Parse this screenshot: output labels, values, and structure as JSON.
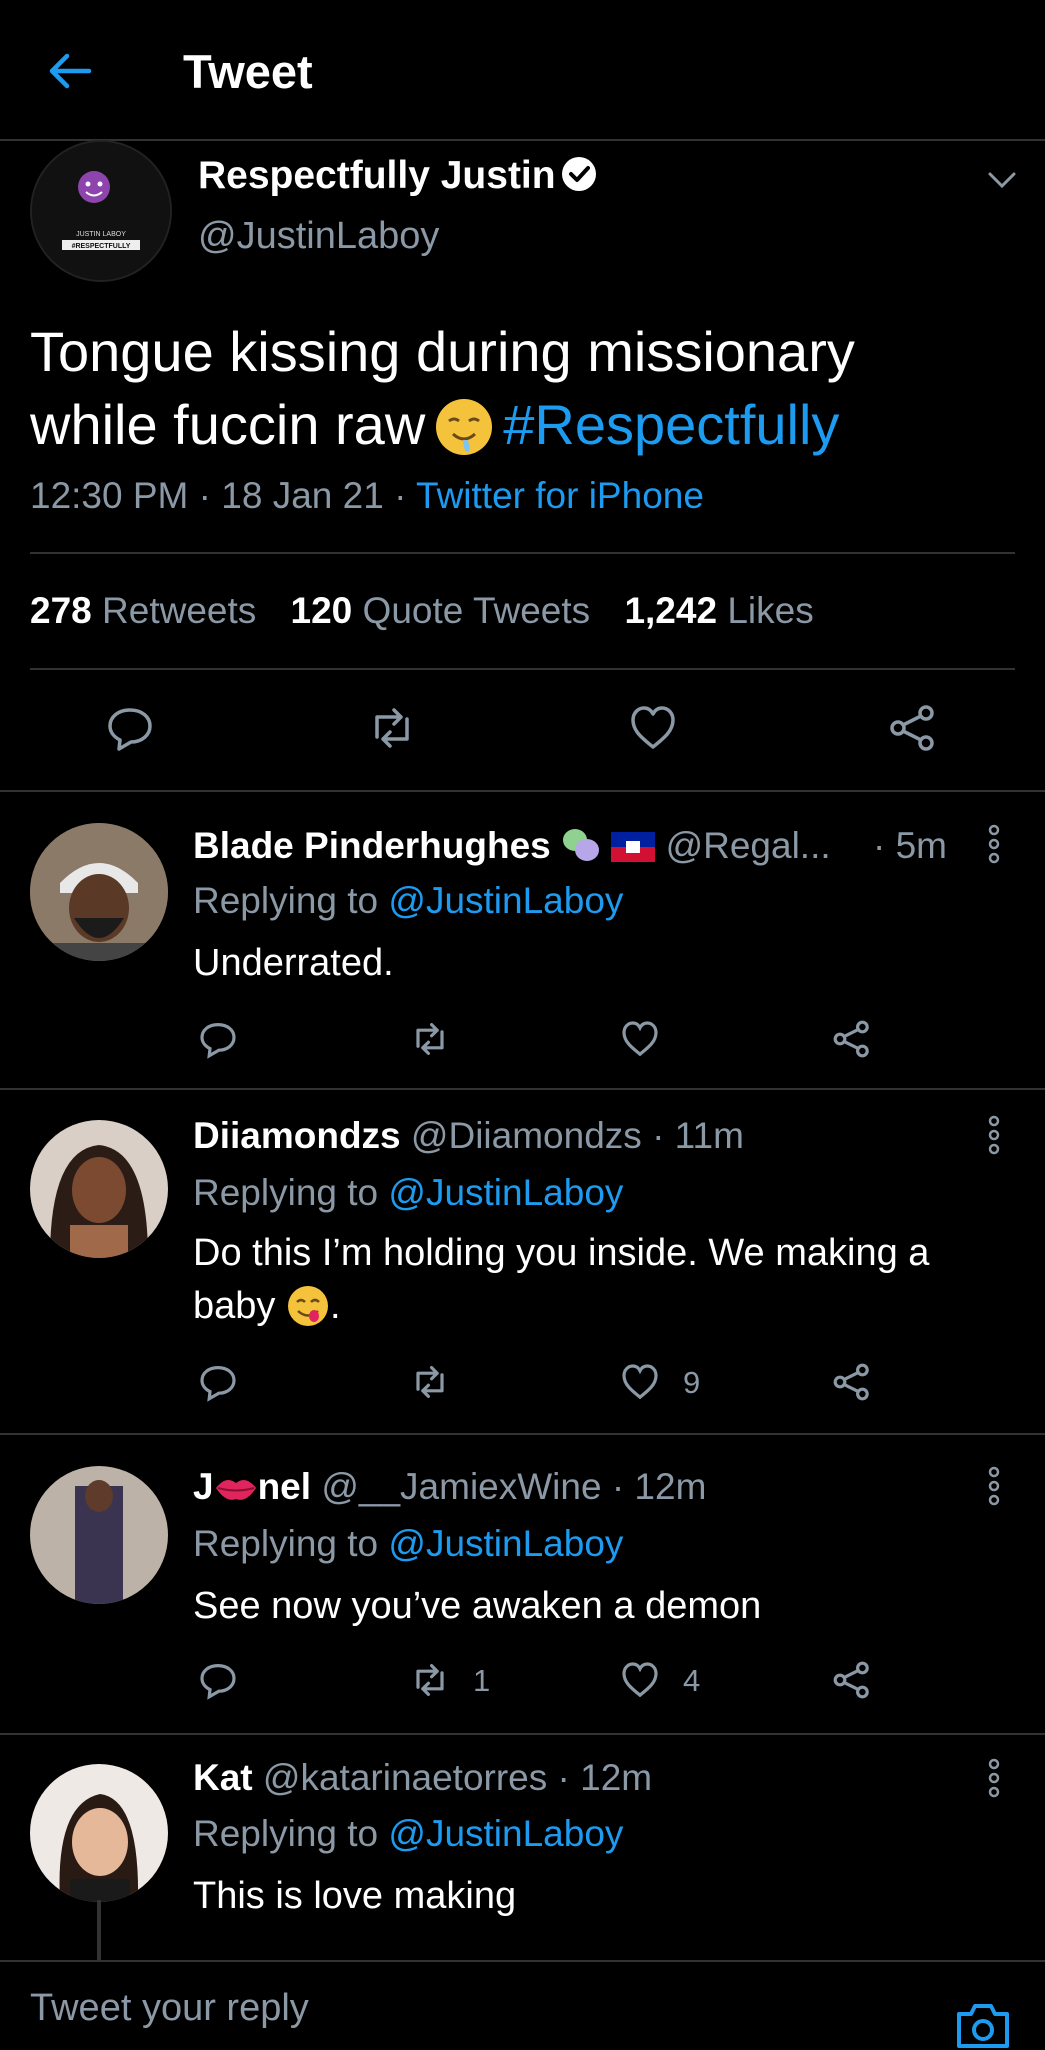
{
  "header": {
    "title": "Tweet"
  },
  "tweet": {
    "author_name": "Respectfully Justin",
    "author_handle": "@JustinLaboy",
    "text_line1": "Tongue kissing during missionary",
    "text_line2": "while fuccin raw",
    "hashtag": "#Respectfully",
    "time": "12:30 PM",
    "date": "18 Jan 21",
    "source": "Twitter for iPhone",
    "retweets_count": "278",
    "retweets_label": "Retweets",
    "quotes_count": "120",
    "quotes_label": "Quote Tweets",
    "likes_count": "1,242",
    "likes_label": "Likes",
    "avatar_text1": "JUSTIN LABOY",
    "avatar_text2": "#RESPECTFULLY"
  },
  "replies": [
    {
      "name": "Blade Pinderhughes",
      "handle": "@Regal...",
      "time": "· 5m",
      "replying_prefix": "Replying to",
      "replying_to": "@JustinLaboy",
      "text": "Underrated.",
      "retweets": "",
      "likes": ""
    },
    {
      "name": "Diiamondzs",
      "handle": "@Diiamondzs",
      "time": "· 11m",
      "replying_prefix": "Replying to",
      "replying_to": "@JustinLaboy",
      "text_line1": "Do this I’m holding you inside. We making a",
      "text_line2": "baby",
      "text_line2_end": ".",
      "retweets": "",
      "likes": "9"
    },
    {
      "name_start": "J",
      "name_end": "nel",
      "handle": "@__JamiexWine",
      "time": "· 12m",
      "replying_prefix": "Replying to",
      "replying_to": "@JustinLaboy",
      "text": "See now you’ve awaken a demon",
      "retweets": "1",
      "likes": "4"
    },
    {
      "name": "Kat",
      "handle": "@katarinaetorres",
      "time": "· 12m",
      "replying_prefix": "Replying to",
      "replying_to": "@JustinLaboy",
      "text": "This is love making"
    }
  ],
  "compose": {
    "placeholder": "Tweet your reply"
  },
  "colors": {
    "accent": "#1d9bf0",
    "muted": "#8b98a5",
    "divider": "#2f3336",
    "background": "#000000"
  }
}
